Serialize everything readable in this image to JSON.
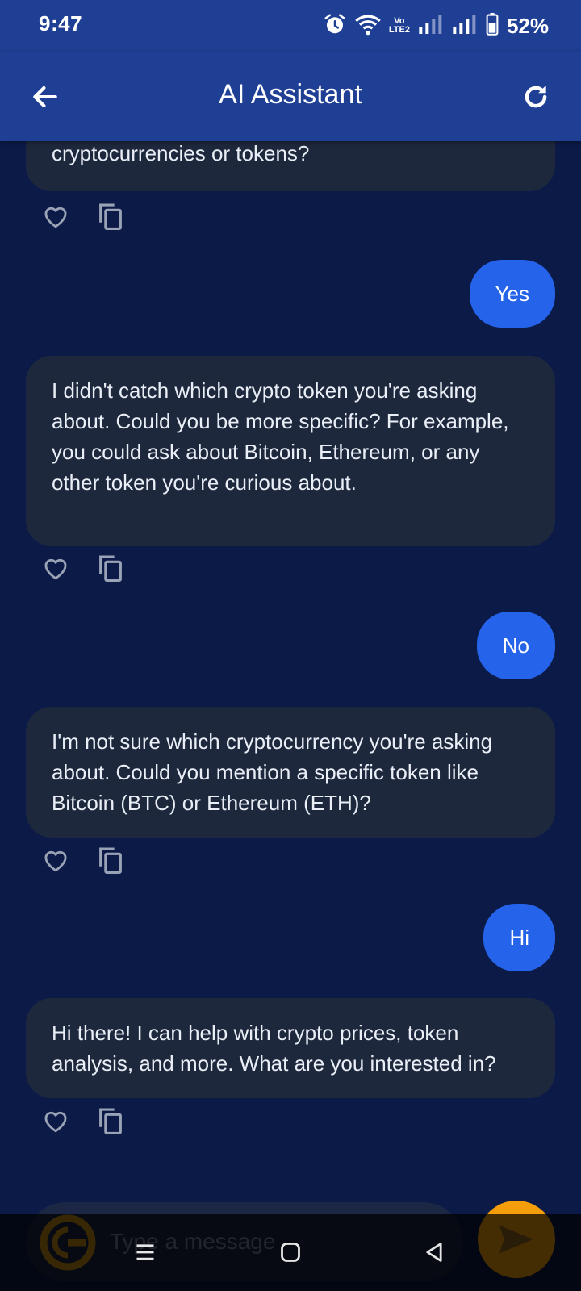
{
  "status_bar": {
    "time": "9:47",
    "battery_percent": "52%",
    "volte_top": "Vo",
    "volte_bottom": "LTE2",
    "icons": [
      "alarm-icon",
      "wifi-icon",
      "volte-icon",
      "signal-icon",
      "signal-icon",
      "battery-icon"
    ]
  },
  "app_bar": {
    "title": "AI Assistant",
    "back_icon": "arrow-left-icon",
    "refresh_icon": "refresh-icon"
  },
  "messages": [
    {
      "role": "assistant",
      "text": "cryptocurrencies or tokens?"
    },
    {
      "role": "user",
      "text": "Yes"
    },
    {
      "role": "assistant",
      "text": "I didn't catch which crypto token you're asking about. Could you be more specific? For example, you could ask about Bitcoin, Ethereum, or any other token you're curious about."
    },
    {
      "role": "user",
      "text": "No"
    },
    {
      "role": "assistant",
      "text": "I'm not sure which cryptocurrency you're asking about. Could you mention a specific token like Bitcoin (BTC) or Ethereum (ETH)?"
    },
    {
      "role": "user",
      "text": "Hi"
    },
    {
      "role": "assistant",
      "text": "Hi there! I can help with crypto prices, token analysis, and more. What are you interested in?"
    }
  ],
  "message_actions": [
    "heart-icon",
    "copy-icon"
  ],
  "input": {
    "placeholder": "Type a message",
    "value": "",
    "send_icon": "send-icon"
  },
  "nav_bar": {
    "buttons": [
      "recent-apps-icon",
      "home-icon",
      "back-icon"
    ]
  },
  "colors": {
    "app_bar": "#1f3f95",
    "background": "#0c1a48",
    "assistant_bubble": "#1e283d",
    "user_bubble": "#2563eb",
    "send_button": "#f59e0b"
  }
}
